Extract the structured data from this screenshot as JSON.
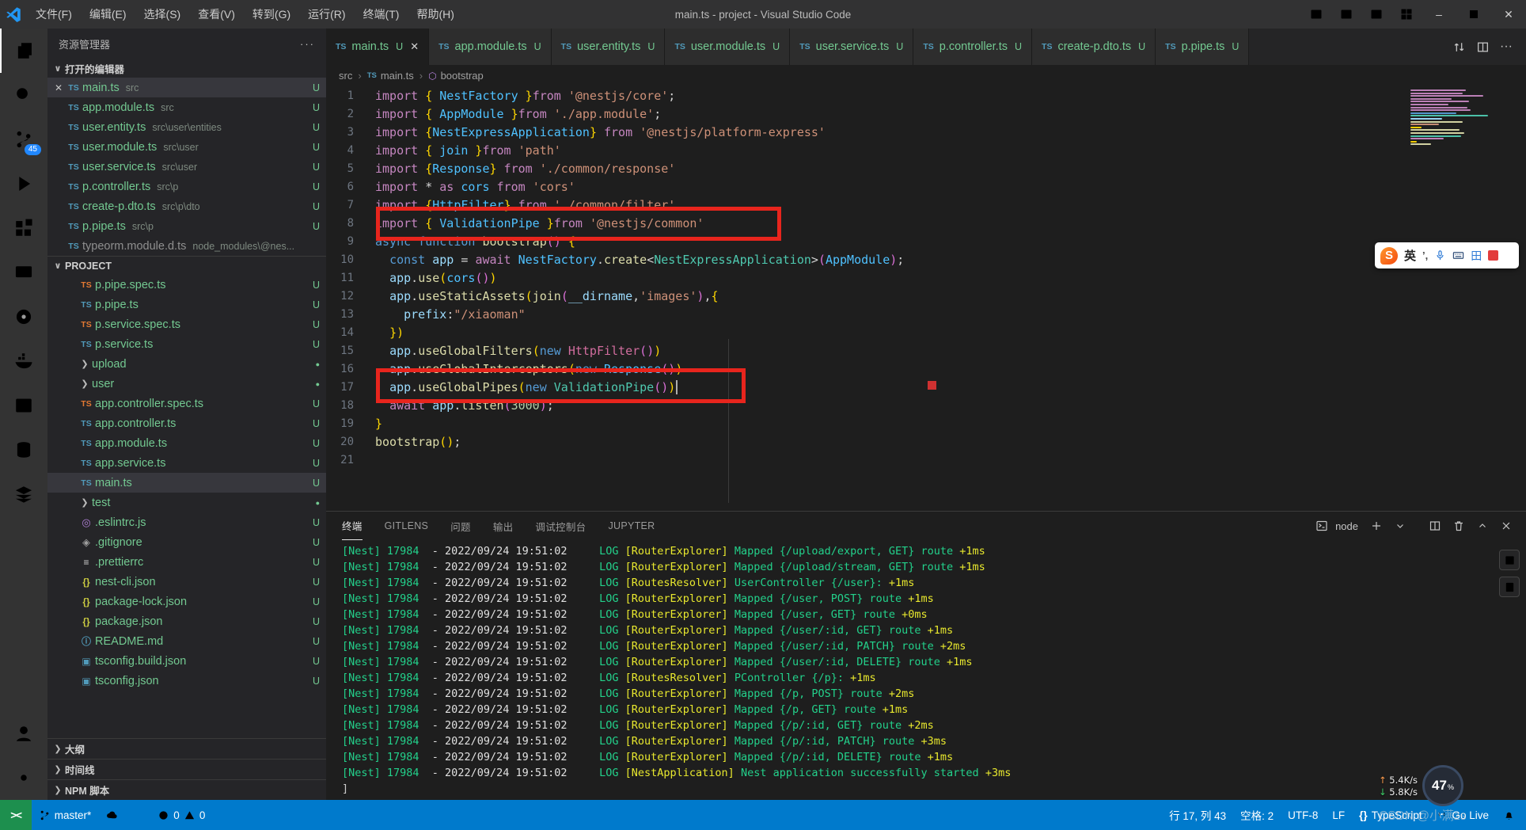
{
  "window": {
    "title": "main.ts - project - Visual Studio Code",
    "menus": [
      "文件(F)",
      "编辑(E)",
      "选择(S)",
      "查看(V)",
      "转到(G)",
      "运行(R)",
      "终端(T)",
      "帮助(H)"
    ]
  },
  "activity_bar": {
    "items": [
      {
        "icon": "files",
        "name": "explorer",
        "active": true
      },
      {
        "icon": "search",
        "name": "search"
      },
      {
        "icon": "scm",
        "name": "source-control",
        "badge": "45"
      },
      {
        "icon": "debug",
        "name": "run-and-debug"
      },
      {
        "icon": "extensions",
        "name": "extensions"
      },
      {
        "icon": "remote",
        "name": "remote-explorer"
      },
      {
        "icon": "circle",
        "name": "live-share"
      },
      {
        "icon": "docker",
        "name": "docker"
      },
      {
        "icon": "termwin",
        "name": "terminal-window"
      },
      {
        "icon": "db",
        "name": "database"
      },
      {
        "icon": "layers",
        "name": "layers"
      }
    ],
    "bottom": [
      {
        "icon": "account",
        "name": "accounts"
      },
      {
        "icon": "gear",
        "name": "settings"
      }
    ]
  },
  "explorer": {
    "title": "资源管理器",
    "open_editors_label": "打开的编辑器",
    "open_editors": [
      {
        "t": "ts",
        "n": "main.ts",
        "p": "src",
        "b": "U",
        "sel": true,
        "close": true
      },
      {
        "t": "ts",
        "n": "app.module.ts",
        "p": "src",
        "b": "U"
      },
      {
        "t": "ts",
        "n": "user.entity.ts",
        "p": "src\\user\\entities",
        "b": "U"
      },
      {
        "t": "ts",
        "n": "user.module.ts",
        "p": "src\\user",
        "b": "U"
      },
      {
        "t": "ts",
        "n": "user.service.ts",
        "p": "src\\user",
        "b": "U"
      },
      {
        "t": "ts",
        "n": "p.controller.ts",
        "p": "src\\p",
        "b": "U"
      },
      {
        "t": "ts",
        "n": "create-p.dto.ts",
        "p": "src\\p\\dto",
        "b": "U"
      },
      {
        "t": "ts",
        "n": "p.pipe.ts",
        "p": "src\\p",
        "b": "U"
      },
      {
        "t": "ts",
        "n": "typeorm.module.d.ts",
        "p": "node_modules\\@nes...",
        "b": "",
        "grey": true
      }
    ],
    "project_label": "PROJECT",
    "project": [
      {
        "t": "tso",
        "n": "p.pipe.spec.ts",
        "b": "U"
      },
      {
        "t": "ts",
        "n": "p.pipe.ts",
        "b": "U"
      },
      {
        "t": "tso",
        "n": "p.service.spec.ts",
        "b": "U"
      },
      {
        "t": "ts",
        "n": "p.service.ts",
        "b": "U"
      },
      {
        "t": "folder",
        "n": "upload",
        "b": "dot"
      },
      {
        "t": "folder",
        "n": "user",
        "b": "dot"
      },
      {
        "t": "tso",
        "n": "app.controller.spec.ts",
        "b": "U"
      },
      {
        "t": "ts",
        "n": "app.controller.ts",
        "b": "U"
      },
      {
        "t": "ts",
        "n": "app.module.ts",
        "b": "U"
      },
      {
        "t": "ts",
        "n": "app.service.ts",
        "b": "U"
      },
      {
        "t": "ts",
        "n": "main.ts",
        "b": "U",
        "sel": true
      },
      {
        "t": "folder",
        "n": "test",
        "b": "dot"
      },
      {
        "t": "eslint",
        "n": ".eslintrc.js",
        "b": "U"
      },
      {
        "t": "gitf",
        "n": ".gitignore",
        "b": "U"
      },
      {
        "t": "pret",
        "n": ".prettierrc",
        "b": "U"
      },
      {
        "t": "json",
        "n": "nest-cli.json",
        "b": "U"
      },
      {
        "t": "json",
        "n": "package-lock.json",
        "b": "U"
      },
      {
        "t": "json",
        "n": "package.json",
        "b": "U"
      },
      {
        "t": "infoi",
        "n": "README.md",
        "b": "U"
      },
      {
        "t": "tsc",
        "n": "tsconfig.build.json",
        "b": "U"
      },
      {
        "t": "tsc",
        "n": "tsconfig.json",
        "b": "U"
      }
    ],
    "footers": [
      "大纲",
      "时间线",
      "NPM 脚本"
    ]
  },
  "tabs": [
    {
      "n": "main.ts",
      "b": "U",
      "active": true,
      "close": true
    },
    {
      "n": "app.module.ts",
      "b": "U"
    },
    {
      "n": "user.entity.ts",
      "b": "U"
    },
    {
      "n": "user.module.ts",
      "b": "U"
    },
    {
      "n": "user.service.ts",
      "b": "U"
    },
    {
      "n": "p.controller.ts",
      "b": "U"
    },
    {
      "n": "create-p.dto.ts",
      "b": "U"
    },
    {
      "n": "p.pipe.ts",
      "b": "U"
    }
  ],
  "breadcrumb": {
    "root": "src",
    "file": "main.ts",
    "symbol": "bootstrap"
  },
  "editor": {
    "lines": [
      {
        "n": 1,
        "tk": [
          [
            "import ",
            "k"
          ],
          [
            "{ ",
            "y"
          ],
          [
            "NestFactory",
            "c"
          ],
          [
            " }",
            "y"
          ],
          [
            "from ",
            "k"
          ],
          [
            "'@nestjs/core'",
            "s"
          ],
          [
            ";",
            "w"
          ]
        ]
      },
      {
        "n": 2,
        "tk": [
          [
            "import ",
            "k"
          ],
          [
            "{ ",
            "y"
          ],
          [
            "AppModule",
            "c"
          ],
          [
            " }",
            "y"
          ],
          [
            "from ",
            "k"
          ],
          [
            "'./app.module'",
            "s"
          ],
          [
            ";",
            "w"
          ]
        ]
      },
      {
        "n": 3,
        "tk": [
          [
            "import ",
            "k"
          ],
          [
            "{",
            "y"
          ],
          [
            "NestExpressApplication",
            "c"
          ],
          [
            "}",
            "y"
          ],
          [
            " from ",
            "k"
          ],
          [
            "'@nestjs/platform-express'",
            "s"
          ]
        ]
      },
      {
        "n": 4,
        "tk": [
          [
            "import ",
            "k"
          ],
          [
            "{ ",
            "y"
          ],
          [
            "join",
            "c"
          ],
          [
            " }",
            "y"
          ],
          [
            "from ",
            "k"
          ],
          [
            "'path'",
            "s"
          ]
        ]
      },
      {
        "n": 5,
        "tk": [
          [
            "import ",
            "k"
          ],
          [
            "{",
            "y"
          ],
          [
            "Response",
            "c"
          ],
          [
            "}",
            "y"
          ],
          [
            " from ",
            "k"
          ],
          [
            "'./common/response'",
            "s"
          ]
        ]
      },
      {
        "n": 6,
        "tk": [
          [
            "import ",
            "k"
          ],
          [
            "* ",
            "w"
          ],
          [
            "as ",
            "k"
          ],
          [
            "cors",
            "c"
          ],
          [
            " from ",
            "k"
          ],
          [
            "'cors'",
            "s"
          ]
        ]
      },
      {
        "n": 7,
        "tk": [
          [
            "import ",
            "k"
          ],
          [
            "{",
            "y"
          ],
          [
            "HttpFilter",
            "c"
          ],
          [
            "}",
            "y"
          ],
          [
            " from ",
            "k"
          ],
          [
            "'./common/filter'",
            "s"
          ]
        ]
      },
      {
        "n": 8,
        "tk": [
          [
            "import ",
            "k"
          ],
          [
            "{ ",
            "y"
          ],
          [
            "ValidationPipe",
            "c"
          ],
          [
            " }",
            "y"
          ],
          [
            "from ",
            "k"
          ],
          [
            "'@nestjs/common'",
            "s"
          ]
        ]
      },
      {
        "n": 9,
        "tk": [
          [
            "async ",
            "b"
          ],
          [
            "function ",
            "b"
          ],
          [
            "bootstrap",
            "f"
          ],
          [
            "(",
            "pu"
          ],
          [
            ")",
            "pu"
          ],
          [
            " {",
            "y"
          ]
        ]
      },
      {
        "n": 10,
        "tk": [
          [
            "  ",
            "w"
          ],
          [
            "const ",
            "b"
          ],
          [
            "app",
            "v"
          ],
          [
            " = ",
            "w"
          ],
          [
            "await ",
            "k"
          ],
          [
            "NestFactory",
            "c"
          ],
          [
            ".",
            "w"
          ],
          [
            "create",
            "f"
          ],
          [
            "<",
            "w"
          ],
          [
            "NestExpressApplication",
            "t"
          ],
          [
            ">",
            "w"
          ],
          [
            "(",
            "pu"
          ],
          [
            "AppModule",
            "c"
          ],
          [
            ")",
            "pu"
          ],
          [
            ";",
            "w"
          ]
        ]
      },
      {
        "n": 11,
        "tk": [
          [
            "  ",
            "w"
          ],
          [
            "app",
            "v"
          ],
          [
            ".",
            "w"
          ],
          [
            "use",
            "f"
          ],
          [
            "(",
            "y"
          ],
          [
            "cors",
            "c"
          ],
          [
            "(",
            "pu"
          ],
          [
            ")",
            "pu"
          ],
          [
            ")",
            "y"
          ]
        ]
      },
      {
        "n": 12,
        "tk": [
          [
            "  ",
            "w"
          ],
          [
            "app",
            "v"
          ],
          [
            ".",
            "w"
          ],
          [
            "useStaticAssets",
            "f"
          ],
          [
            "(",
            "y"
          ],
          [
            "join",
            "f"
          ],
          [
            "(",
            "pu"
          ],
          [
            "__dirname",
            "v"
          ],
          [
            ",",
            "w"
          ],
          [
            "'images'",
            "s"
          ],
          [
            ")",
            "pu"
          ],
          [
            ",",
            "w"
          ],
          [
            "{",
            "y"
          ]
        ]
      },
      {
        "n": 13,
        "tk": [
          [
            "    ",
            "w"
          ],
          [
            "prefix",
            "v"
          ],
          [
            ":",
            "w"
          ],
          [
            "\"/xiaoman\"",
            "s"
          ]
        ]
      },
      {
        "n": 14,
        "tk": [
          [
            "  ",
            "w"
          ],
          [
            "}",
            "y"
          ],
          [
            ")",
            "y"
          ]
        ]
      },
      {
        "n": 15,
        "tk": [
          [
            "  ",
            "w"
          ],
          [
            "app",
            "v"
          ],
          [
            ".",
            "w"
          ],
          [
            "useGlobalFilters",
            "f"
          ],
          [
            "(",
            "y"
          ],
          [
            "new ",
            "b"
          ],
          [
            "HttpFilter",
            "pk"
          ],
          [
            "(",
            "pu"
          ],
          [
            ")",
            "pu"
          ],
          [
            ")",
            "y"
          ]
        ]
      },
      {
        "n": 16,
        "tk": [
          [
            "  ",
            "w"
          ],
          [
            "app",
            "v"
          ],
          [
            ".",
            "w"
          ],
          [
            "useGlobalInterceptors",
            "f"
          ],
          [
            "(",
            "y"
          ],
          [
            "new ",
            "b"
          ],
          [
            "Response",
            "c"
          ],
          [
            "(",
            "pu"
          ],
          [
            ")",
            "pu"
          ],
          [
            ")",
            "y"
          ]
        ]
      },
      {
        "n": 17,
        "tk": [
          [
            "  ",
            "w"
          ],
          [
            "app",
            "v"
          ],
          [
            ".",
            "w"
          ],
          [
            "useGlobalPipes",
            "f"
          ],
          [
            "(",
            "y"
          ],
          [
            "new ",
            "b"
          ],
          [
            "ValidationPipe",
            "t"
          ],
          [
            "(",
            "pu"
          ],
          [
            ")",
            "pu"
          ],
          [
            ")",
            "y"
          ]
        ],
        "cursor": true
      },
      {
        "n": 18,
        "tk": [
          [
            "  ",
            "w"
          ],
          [
            "await ",
            "k"
          ],
          [
            "app",
            "v"
          ],
          [
            ".",
            "w"
          ],
          [
            "listen",
            "f"
          ],
          [
            "(",
            "pu"
          ],
          [
            "3000",
            "n"
          ],
          [
            ")",
            "pu"
          ],
          [
            ";",
            "w"
          ]
        ]
      },
      {
        "n": 19,
        "tk": [
          [
            "}",
            "y"
          ]
        ]
      },
      {
        "n": 20,
        "tk": [
          [
            "bootstrap",
            "f"
          ],
          [
            "(",
            "y"
          ],
          [
            ")",
            "y"
          ],
          [
            ";",
            "w"
          ]
        ]
      },
      {
        "n": 21,
        "tk": []
      }
    ],
    "minimap": [
      "#c586c0 70",
      "#c586c0 66",
      "#c586c0 92",
      "#c586c0 52",
      "#c586c0 74",
      "#c586c0 48",
      "#c586c0 72",
      "#c586c0 76",
      "#569cd6 58",
      "#4ec9b0 98",
      "#9cdcfe 40",
      "#dcdcaa 66",
      "#ce9178 36",
      "#ffd700 14",
      "#dcdcaa 62",
      "#dcdcaa 68",
      "#4ec9b0 64",
      "#c586c0 42",
      "#ffd700 8",
      "#dcdcaa 26"
    ]
  },
  "panel": {
    "tabs": [
      {
        "label": "终端",
        "active": true
      },
      {
        "label": "GITLENS"
      },
      {
        "label": "问题"
      },
      {
        "label": "输出"
      },
      {
        "label": "调试控制台"
      },
      {
        "label": "JUPYTER"
      }
    ],
    "shell_label": "node",
    "log_prefix": {
      "app": "[Nest] 17984",
      "dash": "  - ",
      "ts": "2022/09/24 19:51:02",
      "gap": "     ",
      "level": "LOG "
    },
    "rows": [
      {
        "ctx": "[RouterExplorer] ",
        "msg": "Mapped {/upload/export, GET} route ",
        "ms": "+1ms"
      },
      {
        "ctx": "[RouterExplorer] ",
        "msg": "Mapped {/upload/stream, GET} route ",
        "ms": "+1ms"
      },
      {
        "ctx": "[RoutesResolver] ",
        "msg": "UserController {/user}: ",
        "ms": "+1ms"
      },
      {
        "ctx": "[RouterExplorer] ",
        "msg": "Mapped {/user, POST} route ",
        "ms": "+1ms"
      },
      {
        "ctx": "[RouterExplorer] ",
        "msg": "Mapped {/user, GET} route ",
        "ms": "+0ms"
      },
      {
        "ctx": "[RouterExplorer] ",
        "msg": "Mapped {/user/:id, GET} route ",
        "ms": "+1ms"
      },
      {
        "ctx": "[RouterExplorer] ",
        "msg": "Mapped {/user/:id, PATCH} route ",
        "ms": "+2ms"
      },
      {
        "ctx": "[RouterExplorer] ",
        "msg": "Mapped {/user/:id, DELETE} route ",
        "ms": "+1ms"
      },
      {
        "ctx": "[RoutesResolver] ",
        "msg": "PController {/p}: ",
        "ms": "+1ms"
      },
      {
        "ctx": "[RouterExplorer] ",
        "msg": "Mapped {/p, POST} route ",
        "ms": "+2ms"
      },
      {
        "ctx": "[RouterExplorer] ",
        "msg": "Mapped {/p, GET} route ",
        "ms": "+1ms"
      },
      {
        "ctx": "[RouterExplorer] ",
        "msg": "Mapped {/p/:id, GET} route ",
        "ms": "+2ms"
      },
      {
        "ctx": "[RouterExplorer] ",
        "msg": "Mapped {/p/:id, PATCH} route ",
        "ms": "+3ms"
      },
      {
        "ctx": "[RouterExplorer] ",
        "msg": "Mapped {/p/:id, DELETE} route ",
        "ms": "+1ms"
      },
      {
        "ctx": "[NestApplication] ",
        "msg": "Nest application successfully started ",
        "ms": "+3ms"
      }
    ],
    "trailing": "]"
  },
  "status_bar": {
    "remote": "><",
    "branch": "master*",
    "errors": "0",
    "warnings": "0",
    "line_col": "行 17, 列 43",
    "indent": "空格: 2",
    "encoding": "UTF-8",
    "eol": "LF",
    "lang_icon": "{}",
    "language": "TypeScript",
    "go_live": "Go Live"
  },
  "overlays": {
    "ime": {
      "logo": "S",
      "lang": "英",
      "punc": "’,",
      "grid": "田"
    },
    "netspeed": {
      "up": "5.4K/s",
      "down": "5.8K/s",
      "cpu": "47",
      "unit": "%"
    },
    "watermark": "CSDN @小满zs"
  }
}
